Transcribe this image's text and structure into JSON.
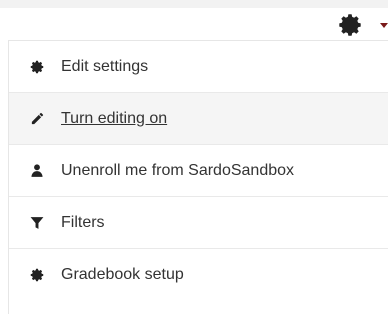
{
  "header": {
    "gear_icon": "gear-icon",
    "caret_icon": "caret-down-icon",
    "caret_color": "#7a1a1a"
  },
  "menu": {
    "items": [
      {
        "label": "Edit settings",
        "icon": "gear-icon"
      },
      {
        "label": "Turn editing on",
        "icon": "pencil-icon",
        "active": true
      },
      {
        "label": "Unenroll me from SardoSandbox",
        "icon": "user-icon"
      },
      {
        "label": "Filters",
        "icon": "filter-icon"
      },
      {
        "label": "Gradebook setup",
        "icon": "gear-icon"
      }
    ]
  },
  "colors": {
    "text": "#333333",
    "icon": "#222222",
    "active_bg": "#f5f5f5",
    "divider": "#e9e9e9"
  }
}
